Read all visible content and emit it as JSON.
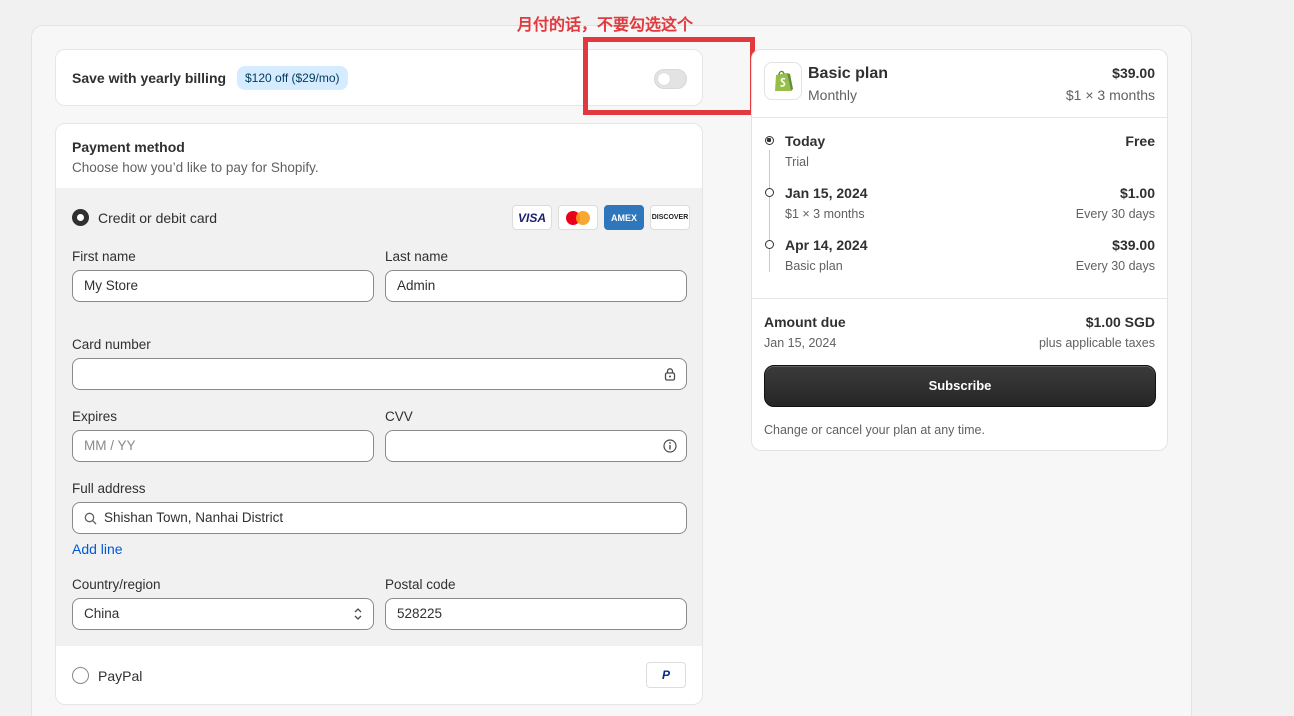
{
  "annotation": {
    "text": "月付的话，不要勾选这个"
  },
  "yearly": {
    "label": "Save with yearly billing",
    "badge": "$120 off ($29/mo)",
    "toggle_on": false
  },
  "payment": {
    "title": "Payment method",
    "subtitle": "Choose how you’d like to pay for Shopify.",
    "card_option": "Credit or debit card",
    "card_brands": [
      "VISA",
      "Mastercard",
      "AMEX",
      "DISCOVER"
    ],
    "first_name_label": "First name",
    "first_name_value": "My Store",
    "last_name_label": "Last name",
    "last_name_value": "Admin",
    "card_number_label": "Card number",
    "card_number_value": "",
    "expires_label": "Expires",
    "expires_placeholder": "MM / YY",
    "cvv_label": "CVV",
    "cvv_value": "",
    "address_label": "Full address",
    "address_value": "Shishan Town, Nanhai District",
    "add_line": "Add line",
    "country_label": "Country/region",
    "country_value": "China",
    "postal_label": "Postal code",
    "postal_value": "528225",
    "paypal_option": "PayPal",
    "paypal_logo": "P"
  },
  "summary": {
    "plan_name": "Basic plan",
    "plan_cycle": "Monthly",
    "plan_price": "$39.00",
    "plan_sub": "$1 × 3 months",
    "timeline": [
      {
        "date": "Today",
        "desc": "Trial",
        "amount": "Free",
        "freq": ""
      },
      {
        "date": "Jan 15, 2024",
        "desc": "$1 × 3 months",
        "amount": "$1.00",
        "freq": "Every 30 days"
      },
      {
        "date": "Apr 14, 2024",
        "desc": "Basic plan",
        "amount": "$39.00",
        "freq": "Every 30 days"
      }
    ],
    "due_label": "Amount due",
    "due_date": "Jan 15, 2024",
    "due_amount": "$1.00 SGD",
    "due_tax": "plus applicable taxes",
    "subscribe": "Subscribe",
    "footnote": "Change or cancel your plan at any time."
  }
}
